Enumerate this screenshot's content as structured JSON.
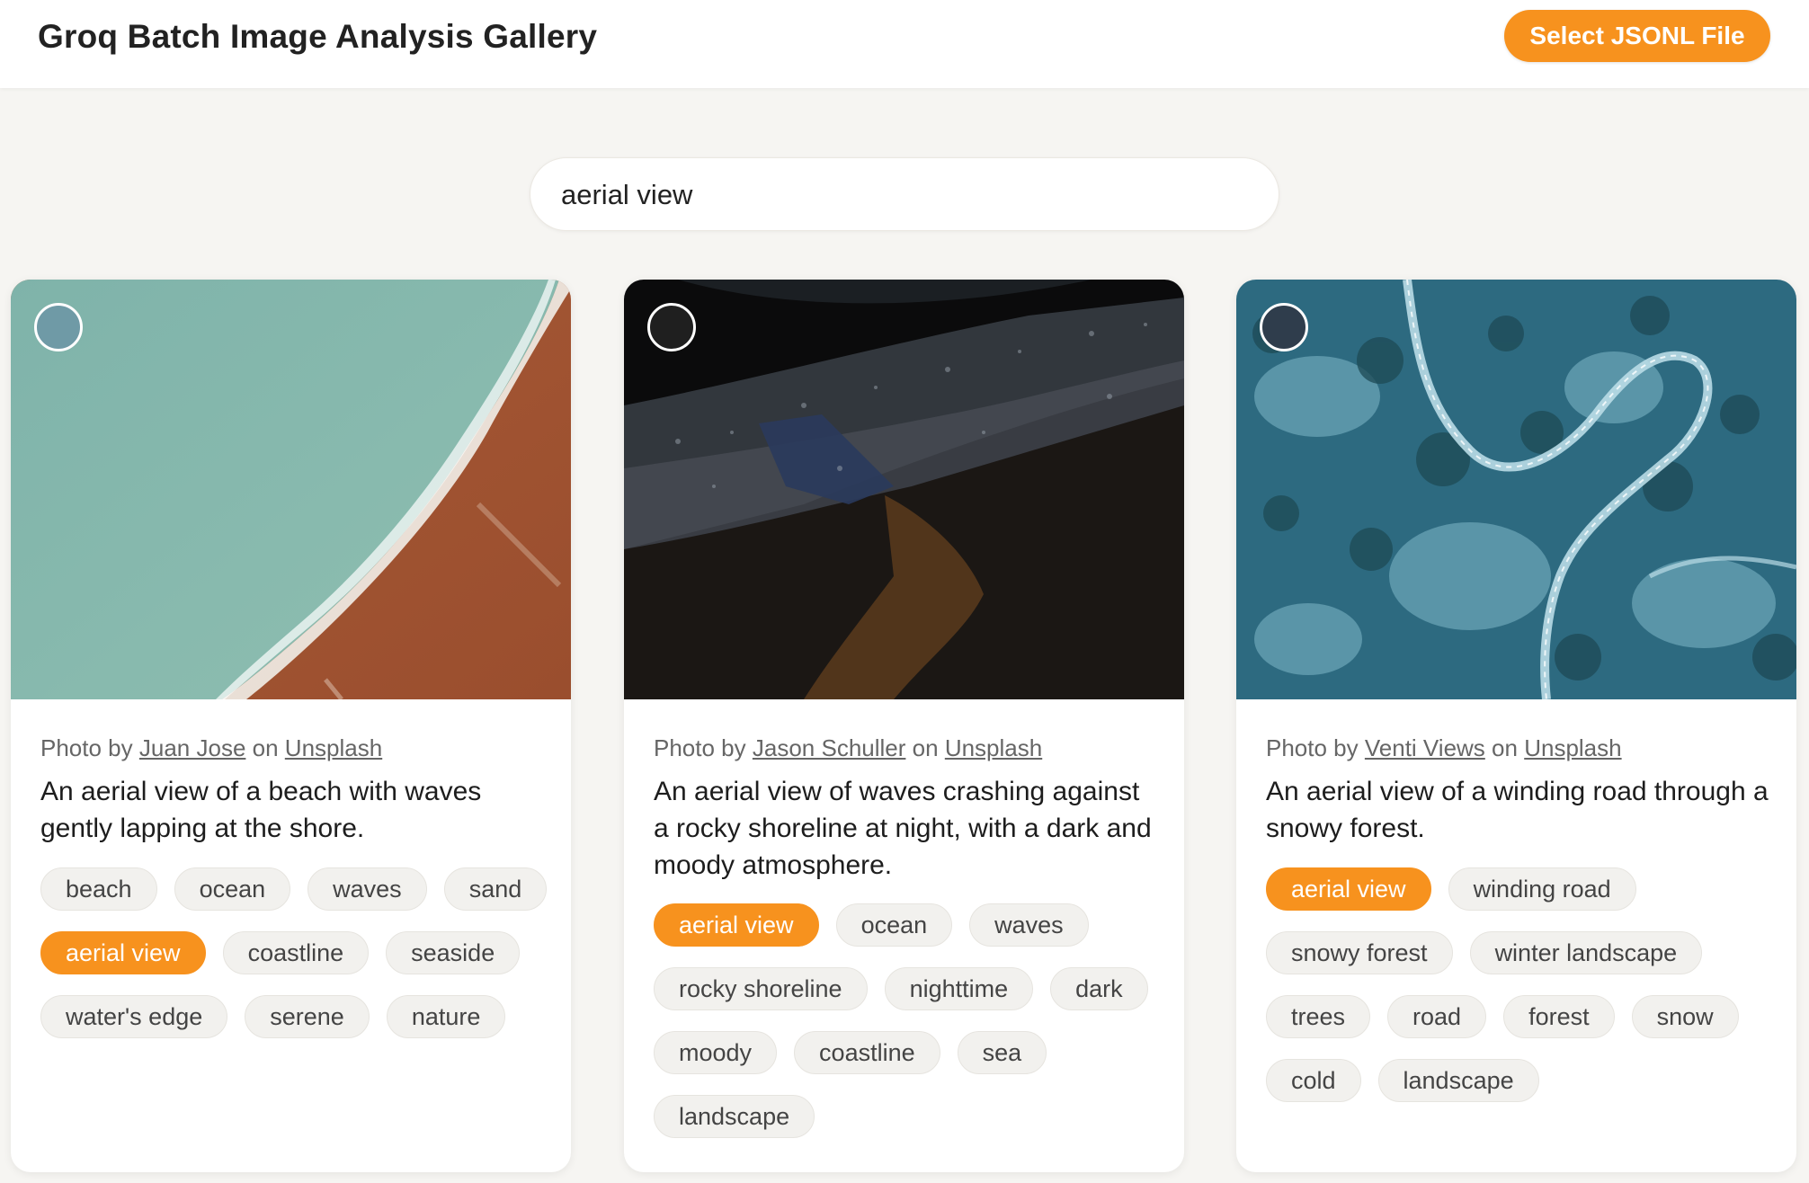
{
  "app": {
    "title": "Groq Batch Image Analysis Gallery",
    "select_button": "Select JSONL File",
    "accent_color": "#f7921e"
  },
  "search": {
    "value": "aerial view",
    "placeholder": ""
  },
  "cards": [
    {
      "credit_prefix": "Photo by",
      "photographer": "Juan Jose",
      "credit_on": "on",
      "source": "Unsplash",
      "caption": "An aerial view of a beach with waves gently lapping at the shore.",
      "selected": false,
      "tags": [
        {
          "label": "beach",
          "active": false
        },
        {
          "label": "ocean",
          "active": false
        },
        {
          "label": "waves",
          "active": false
        },
        {
          "label": "sand",
          "active": false
        },
        {
          "label": "aerial view",
          "active": true
        },
        {
          "label": "coastline",
          "active": false
        },
        {
          "label": "seaside",
          "active": false
        },
        {
          "label": "water's edge",
          "active": false
        },
        {
          "label": "serene",
          "active": false
        },
        {
          "label": "nature",
          "active": false
        }
      ]
    },
    {
      "credit_prefix": "Photo by",
      "photographer": "Jason Schuller",
      "credit_on": "on",
      "source": "Unsplash",
      "caption": "An aerial view of waves crashing against a rocky shoreline at night, with a dark and moody atmosphere.",
      "selected": false,
      "tags": [
        {
          "label": "aerial view",
          "active": true
        },
        {
          "label": "ocean",
          "active": false
        },
        {
          "label": "waves",
          "active": false
        },
        {
          "label": "rocky shoreline",
          "active": false
        },
        {
          "label": "nighttime",
          "active": false
        },
        {
          "label": "dark",
          "active": false
        },
        {
          "label": "moody",
          "active": false
        },
        {
          "label": "coastline",
          "active": false
        },
        {
          "label": "sea",
          "active": false
        },
        {
          "label": "landscape",
          "active": false
        }
      ]
    },
    {
      "credit_prefix": "Photo by",
      "photographer": "Venti Views",
      "credit_on": "on",
      "source": "Unsplash",
      "caption": "An aerial view of a winding road through a snowy forest.",
      "selected": false,
      "tags": [
        {
          "label": "aerial view",
          "active": true
        },
        {
          "label": "winding road",
          "active": false
        },
        {
          "label": "snowy forest",
          "active": false
        },
        {
          "label": "winter landscape",
          "active": false
        },
        {
          "label": "trees",
          "active": false
        },
        {
          "label": "road",
          "active": false
        },
        {
          "label": "forest",
          "active": false
        },
        {
          "label": "snow",
          "active": false
        },
        {
          "label": "cold",
          "active": false
        },
        {
          "label": "landscape",
          "active": false
        }
      ]
    }
  ]
}
